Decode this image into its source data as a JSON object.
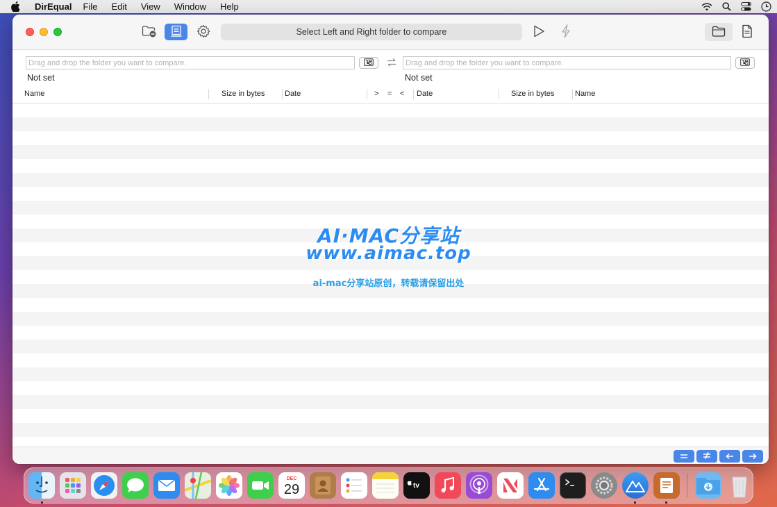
{
  "menubar": {
    "app_name": "DirEqual",
    "items": [
      "File",
      "Edit",
      "View",
      "Window",
      "Help"
    ]
  },
  "toolbar": {
    "status_text": "Select Left and Right folder to compare",
    "accent_color": "#4a86e8"
  },
  "left": {
    "placeholder": "Drag and drop the folder you want to compare.",
    "status": "Not set"
  },
  "right": {
    "placeholder": "Drag and drop the folder you want to compare.",
    "status": "Not set"
  },
  "columns": {
    "left_name": "Name",
    "left_size": "Size in bytes",
    "left_date": "Date",
    "gt": ">",
    "eq": "=",
    "lt": "<",
    "right_date": "Date",
    "right_size": "Size in bytes",
    "right_name": "Name"
  },
  "watermark": {
    "line1": "AI·MAC分享站",
    "line2": "www.aimac.top",
    "line3": "ai-mac分享站原创，转载请保留出处"
  },
  "dock": {
    "calendar_month": "DEC",
    "calendar_day": "29",
    "apps": [
      "finder",
      "launchpad",
      "safari",
      "messages",
      "mail",
      "maps",
      "photos",
      "facetime",
      "calendar",
      "contacts",
      "reminders",
      "notes",
      "tv",
      "music",
      "podcasts",
      "news",
      "app-store",
      "terminal",
      "system-preferences",
      "direqual",
      "text-app",
      "downloads",
      "trash"
    ]
  }
}
